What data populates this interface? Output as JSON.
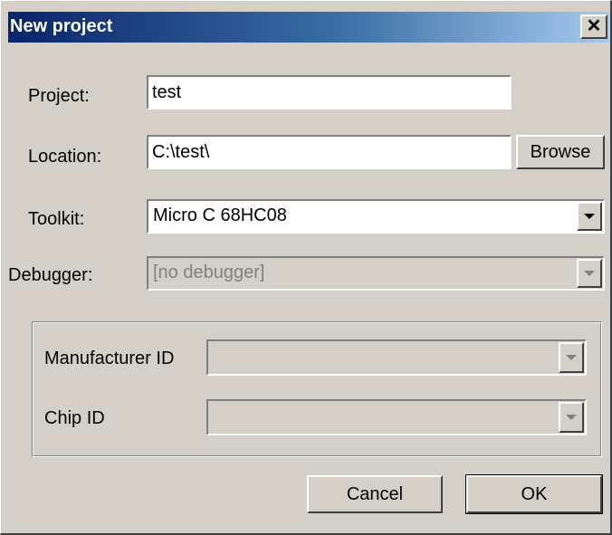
{
  "window": {
    "title": "New project",
    "close_glyph": "✕"
  },
  "form": {
    "project": {
      "label": "Project:",
      "value": "test"
    },
    "location": {
      "label": "Location:",
      "value": "C:\\test\\",
      "browse_label": "Browse"
    },
    "toolkit": {
      "label": "Toolkit:",
      "value": "Micro C 68HC08"
    },
    "debugger": {
      "label": "Debugger:",
      "value": "[no debugger]",
      "disabled": true
    }
  },
  "chip_group": {
    "manufacturer": {
      "label": "Manufacturer ID",
      "value": ""
    },
    "chip": {
      "label": "Chip ID",
      "value": ""
    }
  },
  "actions": {
    "cancel_label": "Cancel",
    "ok_label": "OK"
  },
  "colors": {
    "titlebar_start": "#0a246a",
    "titlebar_end": "#a6caf0",
    "face": "#d4d0c8"
  },
  "icons": {
    "close": "close-icon",
    "dropdown": "chevron-down-icon"
  }
}
